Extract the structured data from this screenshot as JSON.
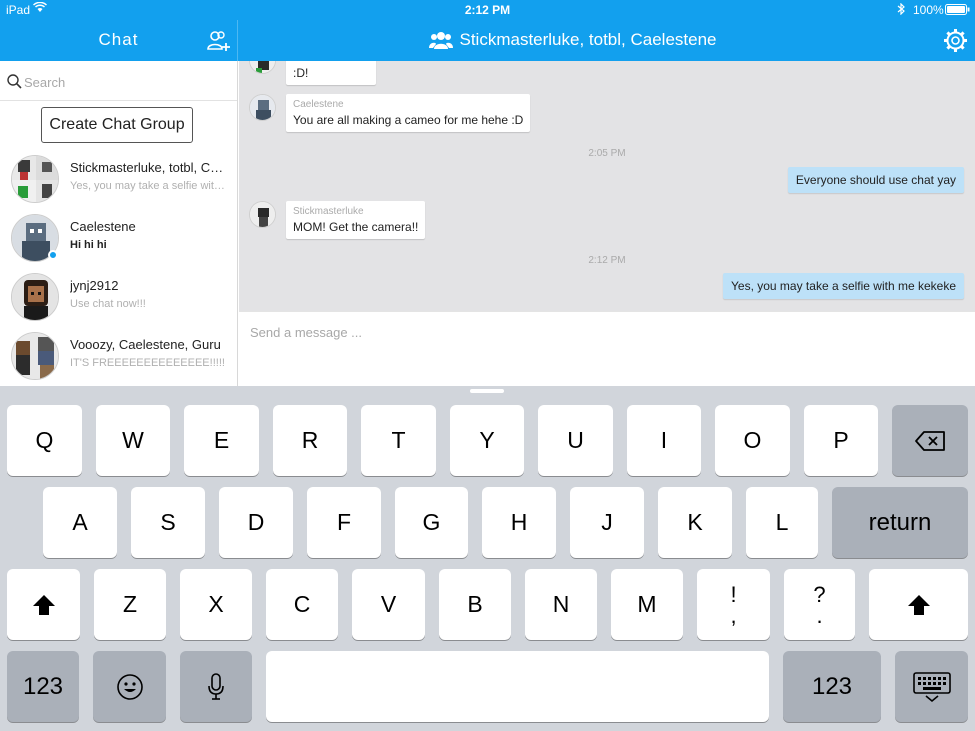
{
  "statusbar": {
    "device": "iPad",
    "time": "2:12 PM",
    "battery": "100%"
  },
  "sidebar": {
    "title": "Chat",
    "search_placeholder": "Search",
    "create_group_label": "Create Chat Group",
    "conversations": [
      {
        "name": "Stickmasterluke, totbl, Caelestene",
        "preview": "Yes, you may take a selfie with me kekeke",
        "unread": false
      },
      {
        "name": "Caelestene",
        "preview": "Hi hi hi",
        "unread": true
      },
      {
        "name": "jynj2912",
        "preview": "Use chat now!!!",
        "unread": false
      },
      {
        "name": "Vooozy, Caelestene, Guru",
        "preview": "IT'S FREEEEEEEEEEEEEE!!!!!",
        "unread": false
      }
    ]
  },
  "conversation": {
    "title": "Stickmasterluke, totbl, Caelestene",
    "messages": [
      {
        "type": "in",
        "sender": "",
        "text": ":D!"
      },
      {
        "type": "in",
        "sender": "Caelestene",
        "text": "You are all making a cameo for me hehe :D"
      },
      {
        "type": "time",
        "text": "2:05 PM"
      },
      {
        "type": "out",
        "text": "Everyone should use chat yay"
      },
      {
        "type": "in",
        "sender": "Stickmasterluke",
        "text": "MOM! Get the camera!!"
      },
      {
        "type": "time",
        "text": "2:12 PM"
      },
      {
        "type": "out",
        "text": "Yes, you may take a selfie with me kekeke"
      }
    ],
    "composer_placeholder": "Send a message ..."
  },
  "keyboard": {
    "row1": [
      "Q",
      "W",
      "E",
      "R",
      "T",
      "Y",
      "U",
      "I",
      "O",
      "P"
    ],
    "row2": [
      "A",
      "S",
      "D",
      "F",
      "G",
      "H",
      "J",
      "K",
      "L"
    ],
    "return_label": "return",
    "row3": [
      "Z",
      "X",
      "C",
      "V",
      "B",
      "N",
      "M"
    ],
    "punct1": [
      "!",
      ","
    ],
    "punct2": [
      "?",
      "."
    ],
    "numbers_label": "123"
  },
  "colors": {
    "header": "#12a0ee",
    "outgoing_bubble": "#bde1f8",
    "keyboard_bg": "#d1d5db"
  }
}
